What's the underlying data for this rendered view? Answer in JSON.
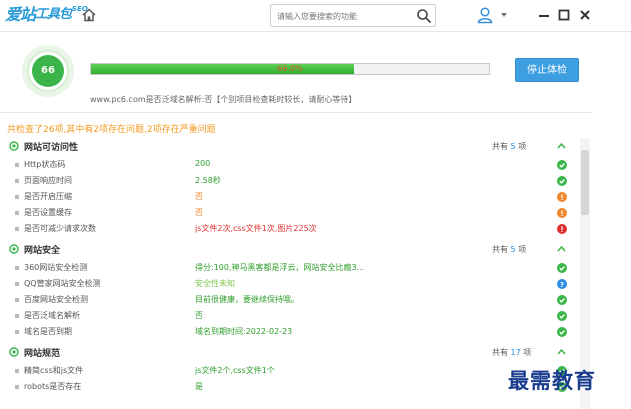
{
  "app": {
    "logo_text": "爱站",
    "logo_sub": "工具包",
    "logo_seo": "SEO"
  },
  "search": {
    "placeholder": "请输入您要搜索的功能"
  },
  "header": {
    "score": "66",
    "progress": {
      "percent": 66.0,
      "text": "66.0%"
    },
    "status": "www.pc6.com是否泛域名解析:否【个别项目检查耗时较长，请耐心等待】",
    "stop_label": "停止体检"
  },
  "summary": "共检查了26项,其中有2项存在问题,2项存在严重问题",
  "colors": {
    "ok": "#3bb549",
    "warn": "#f0852b",
    "err": "#e0302e",
    "info": "#2a8de0",
    "accent": "#3d9ee0"
  },
  "sections": [
    {
      "title": "网站可访问性",
      "count_prefix": "共有",
      "count": "5",
      "count_suffix": "项",
      "rows": [
        {
          "name": "Http状态码",
          "value": "200",
          "tone": "green",
          "status": "ok"
        },
        {
          "name": "页面响应时间",
          "value": "2.58秒",
          "tone": "green",
          "status": "ok"
        },
        {
          "name": "是否开启压缩",
          "value": "否",
          "tone": "orange",
          "status": "warn"
        },
        {
          "name": "是否设置缓存",
          "value": "否",
          "tone": "orange",
          "status": "warn"
        },
        {
          "name": "是否可减少请求次数",
          "value": "js文件2次,css文件1次,图片225次",
          "tone": "red",
          "status": "err"
        }
      ]
    },
    {
      "title": "网站安全",
      "count_prefix": "共有",
      "count": "5",
      "count_suffix": "项",
      "rows": [
        {
          "name": "360网站安全检测",
          "value": "得分:100,神马黑客都是浮云，网站安全比瘾3...",
          "tone": "green",
          "status": "ok"
        },
        {
          "name": "QQ管家网站安全检测",
          "value": "安全性未知",
          "tone": "lightgreen",
          "status": "info"
        },
        {
          "name": "百度网站安全检测",
          "value": "目前很健康，要继续保持哦。",
          "tone": "green",
          "status": "ok"
        },
        {
          "name": "是否泛域名解析",
          "value": "否",
          "tone": "green",
          "status": "ok"
        },
        {
          "name": "域名是否到期",
          "value": "域名到期时间:2022-02-23",
          "tone": "green",
          "status": "ok"
        }
      ]
    },
    {
      "title": "网站规范",
      "count_prefix": "共有",
      "count": "17",
      "count_suffix": "项",
      "rows": [
        {
          "name": "精简css和js文件",
          "value": "js文件2个,css文件1个",
          "tone": "green",
          "status": "ok"
        },
        {
          "name": "robots是否存在",
          "value": "是",
          "tone": "green",
          "status": "ok"
        }
      ]
    }
  ],
  "watermark": "最需教育"
}
